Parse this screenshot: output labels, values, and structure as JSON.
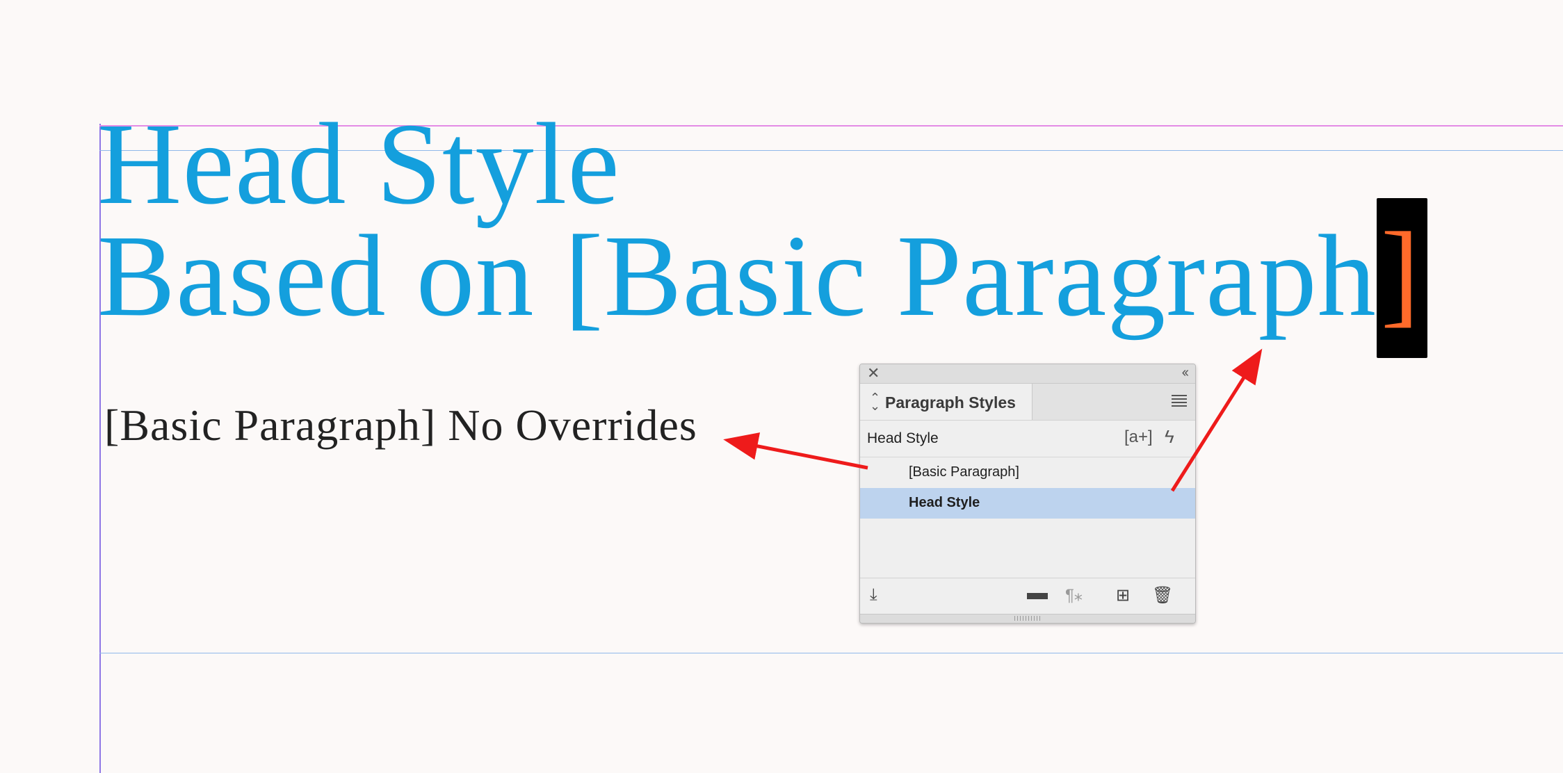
{
  "document": {
    "headline_line1": "Head Style",
    "headline_line2": "Based on [Basic Paragraph",
    "headline_cursor_char": "]",
    "body_line": "[Basic Paragraph] No Overrides"
  },
  "panel": {
    "close_glyph": "✕",
    "collapse_glyph": "‹‹",
    "tab_title": "Paragraph Styles",
    "tab_arrows": "⌃⌄",
    "current_style": "Head Style",
    "new_style_glyph": "[a+]",
    "quick_apply_glyph": "ϟ",
    "styles": [
      {
        "label": "[Basic Paragraph]",
        "selected": false
      },
      {
        "label": "Head Style",
        "selected": true
      }
    ],
    "footer": {
      "load_glyph": "⤓",
      "folder_glyph": "▬",
      "clear_overrides_glyph": "¶⁎",
      "new_glyph": "⊞",
      "delete_glyph": "🗑"
    }
  },
  "colors": {
    "headline": "#149fdd",
    "cursor_char": "#ff6a2a",
    "arrow": "#ee1b1b",
    "selection": "#bdd3ee"
  }
}
